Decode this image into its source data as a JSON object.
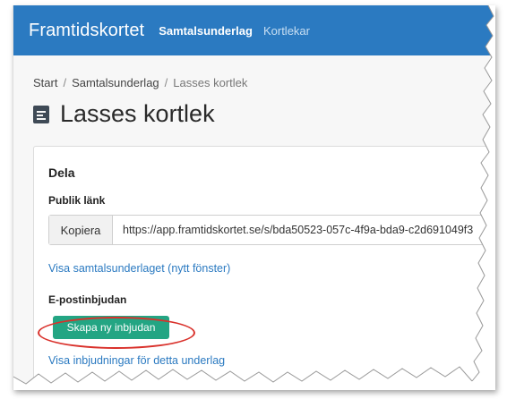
{
  "navbar": {
    "brand": "Framtidskortet",
    "links": [
      {
        "label": "Samtalsunderlag",
        "active": true
      },
      {
        "label": "Kortlekar",
        "active": false
      }
    ]
  },
  "breadcrumb": {
    "items": [
      "Start",
      "Samtalsunderlag",
      "Lasses kortlek"
    ],
    "separator": "/"
  },
  "page": {
    "title": "Lasses kortlek",
    "title_icon": "document-icon"
  },
  "share": {
    "heading": "Dela",
    "public_link_label": "Publik länk",
    "copy_label": "Kopiera",
    "url": "https://app.framtidskortet.se/s/bda50523-057c-4f9a-bda9-c2d691049f3",
    "open_link": "Visa samtalsunderlaget (nytt fönster)",
    "email_label": "E-postinbjudan",
    "new_invite_button": "Skapa ny inbjudan",
    "invites_link": "Visa inbjudningar för detta underlag"
  },
  "colors": {
    "navbar": "#2b7ac1",
    "primary_button": "#23a583",
    "link": "#2b7ac1",
    "highlight": "#d9312b"
  }
}
